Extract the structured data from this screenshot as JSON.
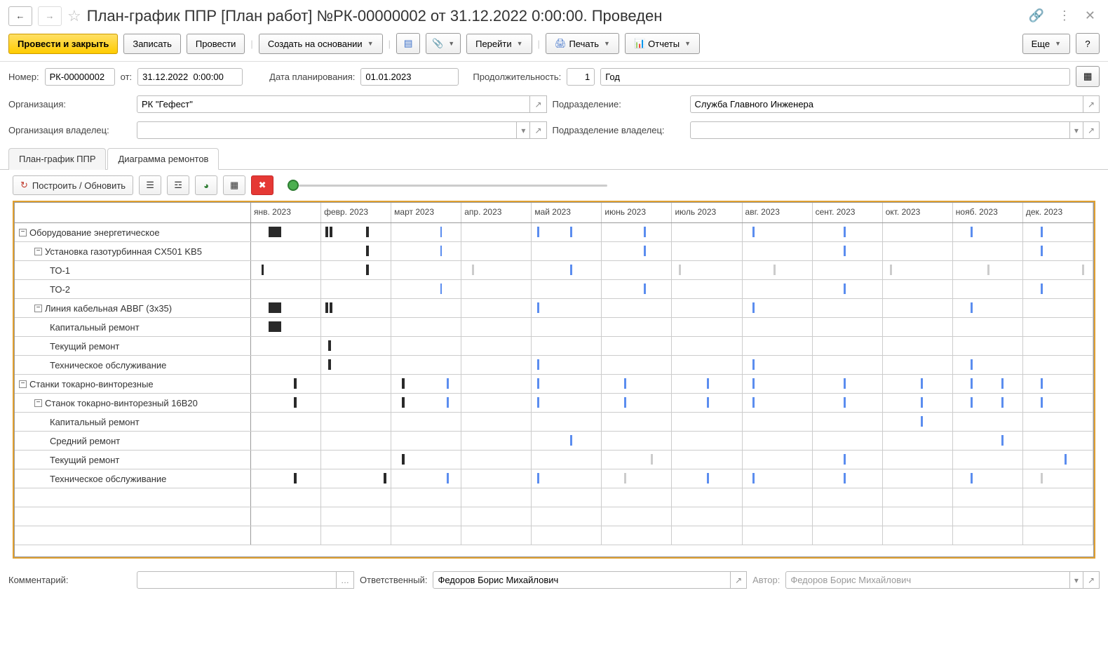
{
  "header": {
    "title": "План-график ППР [План работ] №РК-00000002 от 31.12.2022 0:00:00. Проведен"
  },
  "toolbar": {
    "post_close": "Провести и закрыть",
    "save": "Записать",
    "post": "Провести",
    "create_based": "Создать на основании",
    "goto": "Перейти",
    "print": "Печать",
    "reports": "Отчеты",
    "more": "Еще"
  },
  "form": {
    "number_label": "Номер:",
    "number": "РК-00000002",
    "from_label": "от:",
    "date": "31.12.2022  0:00:00",
    "plan_date_label": "Дата планирования:",
    "plan_date": "01.01.2023",
    "duration_label": "Продолжительность:",
    "duration": "1",
    "unit": "Год",
    "org_label": "Организация:",
    "org": "РК \"Гефест\"",
    "dept_label": "Подразделение:",
    "dept": "Служба Главного Инженера",
    "org_owner_label": "Организация владелец:",
    "dept_owner_label": "Подразделение владелец:"
  },
  "tabs": {
    "tab1": "План-график ППР",
    "tab2": "Диаграмма ремонтов"
  },
  "toolbar2": {
    "build": "Построить / Обновить"
  },
  "months": [
    "янв. 2023",
    "февр. 2023",
    "март 2023",
    "апр. 2023",
    "май 2023",
    "июнь 2023",
    "июль 2023",
    "авг. 2023",
    "сент. 2023",
    "окт. 2023",
    "нояб. 2023",
    "дек. 2023"
  ],
  "rows": [
    {
      "label": "Оборудование энергетическое",
      "indent": 0,
      "expand": true,
      "bars": [
        {
          "m": 0,
          "x": 25,
          "w": 18,
          "c": "dark"
        },
        {
          "m": 1,
          "x": 6,
          "w": 4,
          "c": "dark"
        },
        {
          "m": 1,
          "x": 12,
          "w": 4,
          "c": "dark"
        },
        {
          "m": 1,
          "x": 65,
          "w": 4,
          "c": "dark"
        },
        {
          "m": 2,
          "x": 70,
          "w": 3,
          "c": "blue"
        },
        {
          "m": 4,
          "x": 8,
          "w": 3,
          "c": "blue"
        },
        {
          "m": 4,
          "x": 55,
          "w": 3,
          "c": "blue"
        },
        {
          "m": 5,
          "x": 60,
          "w": 3,
          "c": "blue"
        },
        {
          "m": 7,
          "x": 15,
          "w": 3,
          "c": "blue"
        },
        {
          "m": 8,
          "x": 45,
          "w": 3,
          "c": "blue"
        },
        {
          "m": 10,
          "x": 25,
          "w": 3,
          "c": "blue"
        },
        {
          "m": 11,
          "x": 25,
          "w": 3,
          "c": "blue"
        }
      ]
    },
    {
      "label": "Установка газотурбинная CX501 KB5",
      "indent": 1,
      "expand": true,
      "bars": [
        {
          "m": 1,
          "x": 65,
          "w": 4,
          "c": "dark"
        },
        {
          "m": 2,
          "x": 70,
          "w": 3,
          "c": "blue"
        },
        {
          "m": 5,
          "x": 60,
          "w": 3,
          "c": "blue"
        },
        {
          "m": 8,
          "x": 45,
          "w": 3,
          "c": "blue"
        },
        {
          "m": 11,
          "x": 25,
          "w": 3,
          "c": "blue"
        }
      ]
    },
    {
      "label": "ТО-1",
      "indent": 2,
      "expand": false,
      "bars": [
        {
          "m": 0,
          "x": 15,
          "w": 3,
          "c": "dark"
        },
        {
          "m": 1,
          "x": 65,
          "w": 4,
          "c": "dark"
        },
        {
          "m": 3,
          "x": 15,
          "w": 3,
          "c": "gray"
        },
        {
          "m": 4,
          "x": 55,
          "w": 3,
          "c": "blue"
        },
        {
          "m": 6,
          "x": 10,
          "w": 3,
          "c": "gray"
        },
        {
          "m": 7,
          "x": 45,
          "w": 3,
          "c": "gray"
        },
        {
          "m": 9,
          "x": 10,
          "w": 3,
          "c": "gray"
        },
        {
          "m": 10,
          "x": 50,
          "w": 3,
          "c": "gray"
        },
        {
          "m": 11,
          "x": 85,
          "w": 3,
          "c": "gray"
        }
      ]
    },
    {
      "label": "ТО-2",
      "indent": 2,
      "expand": false,
      "bars": [
        {
          "m": 2,
          "x": 70,
          "w": 3,
          "c": "blue"
        },
        {
          "m": 5,
          "x": 60,
          "w": 3,
          "c": "blue"
        },
        {
          "m": 8,
          "x": 45,
          "w": 3,
          "c": "blue"
        },
        {
          "m": 11,
          "x": 25,
          "w": 3,
          "c": "blue"
        }
      ]
    },
    {
      "label": "Линия кабельная АВВГ (3х35)",
      "indent": 1,
      "expand": true,
      "bars": [
        {
          "m": 0,
          "x": 25,
          "w": 18,
          "c": "dark"
        },
        {
          "m": 1,
          "x": 6,
          "w": 4,
          "c": "dark"
        },
        {
          "m": 1,
          "x": 12,
          "w": 4,
          "c": "dark"
        },
        {
          "m": 4,
          "x": 8,
          "w": 3,
          "c": "blue"
        },
        {
          "m": 7,
          "x": 15,
          "w": 3,
          "c": "blue"
        },
        {
          "m": 10,
          "x": 25,
          "w": 3,
          "c": "blue"
        }
      ]
    },
    {
      "label": "Капитальный ремонт",
      "indent": 2,
      "expand": false,
      "bars": [
        {
          "m": 0,
          "x": 25,
          "w": 18,
          "c": "dark"
        }
      ]
    },
    {
      "label": "Текущий ремонт",
      "indent": 2,
      "expand": false,
      "bars": [
        {
          "m": 1,
          "x": 10,
          "w": 4,
          "c": "dark"
        }
      ]
    },
    {
      "label": "Техническое обслуживание",
      "indent": 2,
      "expand": false,
      "bars": [
        {
          "m": 1,
          "x": 10,
          "w": 4,
          "c": "dark"
        },
        {
          "m": 4,
          "x": 8,
          "w": 3,
          "c": "blue"
        },
        {
          "m": 7,
          "x": 15,
          "w": 3,
          "c": "blue"
        },
        {
          "m": 10,
          "x": 25,
          "w": 3,
          "c": "blue"
        }
      ]
    },
    {
      "label": "Станки токарно-винторезные",
      "indent": 0,
      "expand": true,
      "bars": [
        {
          "m": 0,
          "x": 62,
          "w": 4,
          "c": "dark"
        },
        {
          "m": 2,
          "x": 15,
          "w": 4,
          "c": "dark"
        },
        {
          "m": 2,
          "x": 80,
          "w": 3,
          "c": "blue"
        },
        {
          "m": 4,
          "x": 8,
          "w": 3,
          "c": "blue"
        },
        {
          "m": 5,
          "x": 32,
          "w": 3,
          "c": "blue"
        },
        {
          "m": 6,
          "x": 50,
          "w": 3,
          "c": "blue"
        },
        {
          "m": 7,
          "x": 15,
          "w": 3,
          "c": "blue"
        },
        {
          "m": 8,
          "x": 45,
          "w": 3,
          "c": "blue"
        },
        {
          "m": 9,
          "x": 55,
          "w": 3,
          "c": "blue"
        },
        {
          "m": 10,
          "x": 25,
          "w": 3,
          "c": "blue"
        },
        {
          "m": 10,
          "x": 70,
          "w": 3,
          "c": "blue"
        },
        {
          "m": 11,
          "x": 25,
          "w": 3,
          "c": "blue"
        }
      ]
    },
    {
      "label": "Станок токарно-винторезный 16В20",
      "indent": 1,
      "expand": true,
      "bars": [
        {
          "m": 0,
          "x": 62,
          "w": 4,
          "c": "dark"
        },
        {
          "m": 2,
          "x": 15,
          "w": 4,
          "c": "dark"
        },
        {
          "m": 2,
          "x": 80,
          "w": 3,
          "c": "blue"
        },
        {
          "m": 4,
          "x": 8,
          "w": 3,
          "c": "blue"
        },
        {
          "m": 5,
          "x": 32,
          "w": 3,
          "c": "blue"
        },
        {
          "m": 6,
          "x": 50,
          "w": 3,
          "c": "blue"
        },
        {
          "m": 7,
          "x": 15,
          "w": 3,
          "c": "blue"
        },
        {
          "m": 8,
          "x": 45,
          "w": 3,
          "c": "blue"
        },
        {
          "m": 9,
          "x": 55,
          "w": 3,
          "c": "blue"
        },
        {
          "m": 10,
          "x": 25,
          "w": 3,
          "c": "blue"
        },
        {
          "m": 10,
          "x": 70,
          "w": 3,
          "c": "blue"
        },
        {
          "m": 11,
          "x": 25,
          "w": 3,
          "c": "blue"
        }
      ]
    },
    {
      "label": "Капитальный ремонт",
      "indent": 2,
      "expand": false,
      "bars": [
        {
          "m": 9,
          "x": 55,
          "w": 3,
          "c": "blue"
        }
      ]
    },
    {
      "label": "Средний ремонт",
      "indent": 2,
      "expand": false,
      "bars": [
        {
          "m": 4,
          "x": 55,
          "w": 3,
          "c": "blue"
        },
        {
          "m": 10,
          "x": 70,
          "w": 3,
          "c": "blue"
        }
      ]
    },
    {
      "label": "Текущий ремонт",
      "indent": 2,
      "expand": false,
      "bars": [
        {
          "m": 2,
          "x": 15,
          "w": 4,
          "c": "dark"
        },
        {
          "m": 5,
          "x": 70,
          "w": 3,
          "c": "gray"
        },
        {
          "m": 8,
          "x": 45,
          "w": 3,
          "c": "blue"
        },
        {
          "m": 11,
          "x": 60,
          "w": 3,
          "c": "blue"
        }
      ]
    },
    {
      "label": "Техническое обслуживание",
      "indent": 2,
      "expand": false,
      "bars": [
        {
          "m": 0,
          "x": 62,
          "w": 4,
          "c": "dark"
        },
        {
          "m": 1,
          "x": 90,
          "w": 4,
          "c": "dark"
        },
        {
          "m": 2,
          "x": 80,
          "w": 3,
          "c": "blue"
        },
        {
          "m": 4,
          "x": 8,
          "w": 3,
          "c": "blue"
        },
        {
          "m": 5,
          "x": 32,
          "w": 3,
          "c": "gray"
        },
        {
          "m": 6,
          "x": 50,
          "w": 3,
          "c": "blue"
        },
        {
          "m": 7,
          "x": 15,
          "w": 3,
          "c": "blue"
        },
        {
          "m": 8,
          "x": 45,
          "w": 3,
          "c": "blue"
        },
        {
          "m": 10,
          "x": 25,
          "w": 3,
          "c": "blue"
        },
        {
          "m": 11,
          "x": 25,
          "w": 3,
          "c": "gray"
        }
      ]
    }
  ],
  "footer": {
    "comment_label": "Комментарий:",
    "responsible_label": "Ответственный:",
    "responsible": "Федоров Борис Михайлович",
    "author_label": "Автор:",
    "author": "Федоров Борис Михайлович"
  }
}
